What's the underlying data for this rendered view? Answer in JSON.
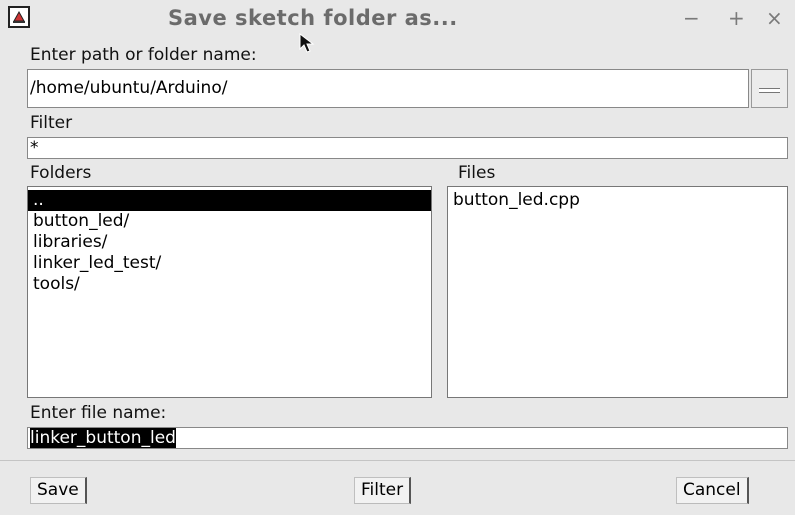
{
  "window": {
    "title": "Save sketch folder as...",
    "minimize": "−",
    "maximize": "+",
    "close": "×"
  },
  "path": {
    "label": "Enter path or folder name:",
    "value": "/home/ubuntu/Arduino/"
  },
  "filter": {
    "label": "Filter",
    "value": "*"
  },
  "folders": {
    "label": "Folders",
    "items": [
      "..",
      "button_led/",
      "libraries/",
      "linker_led_test/",
      "tools/"
    ]
  },
  "files": {
    "label": "Files",
    "items": [
      "button_led.cpp"
    ]
  },
  "filename": {
    "label": "Enter file name:",
    "value": "linker_button_led"
  },
  "buttons": {
    "save": "Save",
    "filter": "Filter",
    "cancel": "Cancel"
  },
  "icons": {
    "app": "arduino-java-icon",
    "cursor": "mouse-pointer-icon"
  }
}
